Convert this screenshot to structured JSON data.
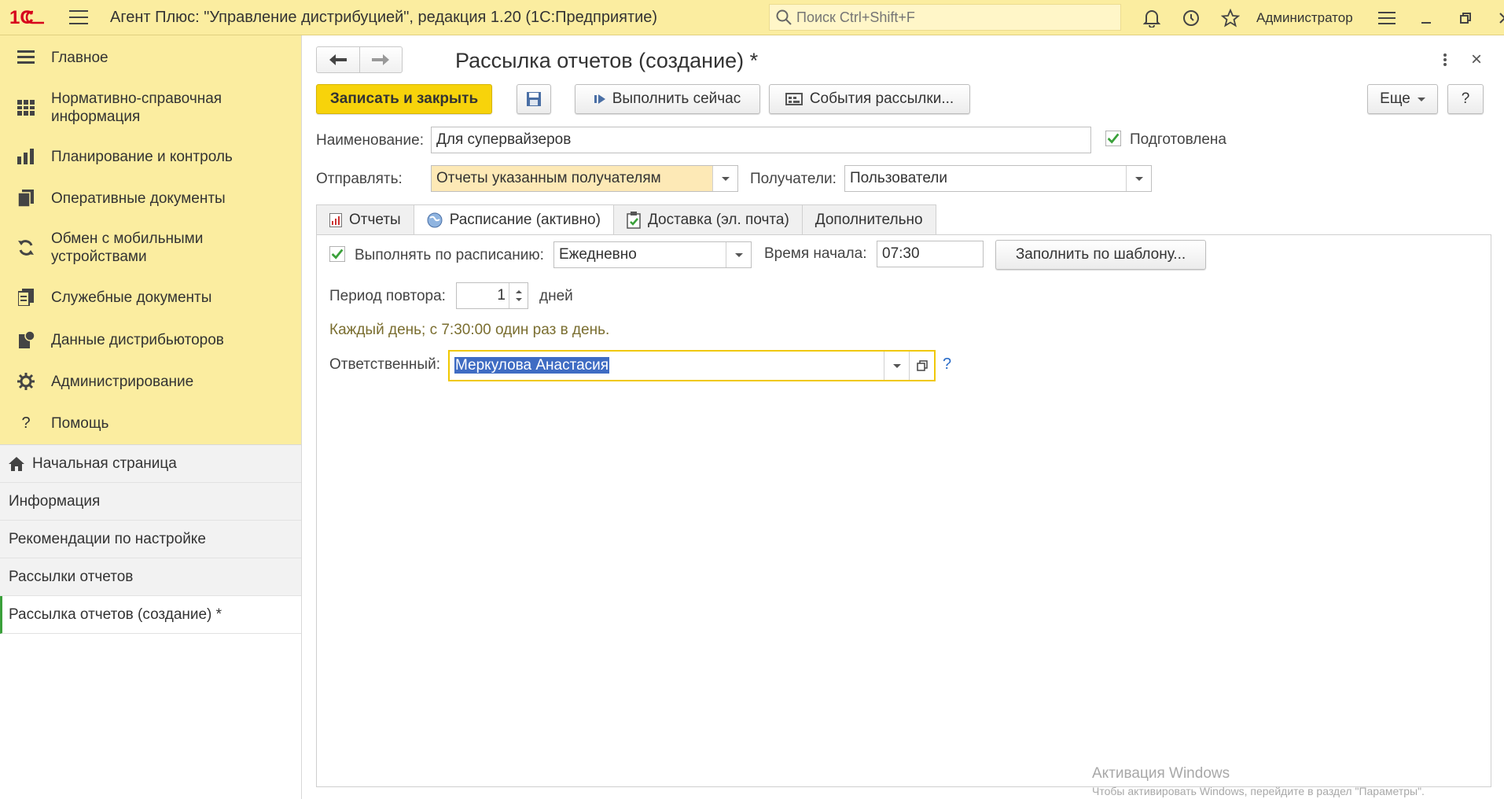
{
  "titlebar": {
    "logo_text": "1С",
    "title": "Агент Плюс: \"Управление дистрибуцией\", редакция 1.20  (1С:Предприятие)",
    "search_placeholder": "Поиск Ctrl+Shift+F",
    "user": "Администратор"
  },
  "sidebar": {
    "sections": [
      {
        "label": "Главное",
        "icon": "menu-list-icon"
      },
      {
        "label": "Нормативно-справочная информация",
        "icon": "catalog-grid-icon"
      },
      {
        "label": "Планирование и контроль",
        "icon": "bar-chart-icon"
      },
      {
        "label": "Оперативные документы",
        "icon": "documents-icon"
      },
      {
        "label": "Обмен с мобильными устройствами",
        "icon": "sync-icon"
      },
      {
        "label": "Служебные документы",
        "icon": "service-documents-icon"
      },
      {
        "label": "Данные дистрибьюторов",
        "icon": "distributor-data-icon"
      },
      {
        "label": "Администрирование",
        "icon": "gear-icon"
      },
      {
        "label": "Помощь",
        "icon": "question-icon"
      }
    ],
    "open_windows": [
      {
        "label": "Начальная страница",
        "icon": "home-icon"
      },
      {
        "label": "Информация"
      },
      {
        "label": "Рекомендации по настройке"
      },
      {
        "label": "Рассылки отчетов"
      },
      {
        "label": "Рассылка отчетов (создание) *",
        "active": true
      }
    ]
  },
  "form": {
    "title": "Рассылка отчетов (создание) *",
    "toolbar": {
      "save_close": "Записать и закрыть",
      "run_now": "Выполнить сейчас",
      "events": "События рассылки...",
      "more": "Еще",
      "help": "?"
    },
    "name_label": "Наименование:",
    "name_value": "Для супервайзеров",
    "prepared_label": "Подготовлена",
    "prepared_checked": true,
    "send_label": "Отправлять:",
    "send_value": "Отчеты указанным получателям",
    "recipients_label": "Получатели:",
    "recipients_value": "Пользователи",
    "tabs": [
      {
        "label": "Отчеты",
        "icon": "report-icon"
      },
      {
        "label": "Расписание (активно)",
        "icon": "globe-icon",
        "active": true
      },
      {
        "label": "Доставка (эл. почта)",
        "icon": "clipboard-check-icon"
      },
      {
        "label": "Дополнительно"
      }
    ],
    "schedule": {
      "run_label": "Выполнять по расписанию:",
      "run_checked": true,
      "frequency": "Ежедневно",
      "start_label": "Время начала:",
      "start_value": "07:30",
      "fill_template": "Заполнить по шаблону...",
      "period_label": "Период повтора:",
      "period_value": "1",
      "period_unit": "дней",
      "description": "Каждый день; с 7:30:00 один раз в день.",
      "responsible_label": "Ответственный:",
      "responsible_value": "Меркулова Анастасия",
      "help": "?"
    }
  },
  "watermark": {
    "line1": "Активация Windows",
    "line2": "Чтобы активировать Windows, перейдите в раздел \"Параметры\"."
  },
  "colors": {
    "header_yellow": "#fbeda0",
    "primary_button": "#f7d30b",
    "active_green": "#3aa03a",
    "link_blue": "#2a6cc8"
  }
}
